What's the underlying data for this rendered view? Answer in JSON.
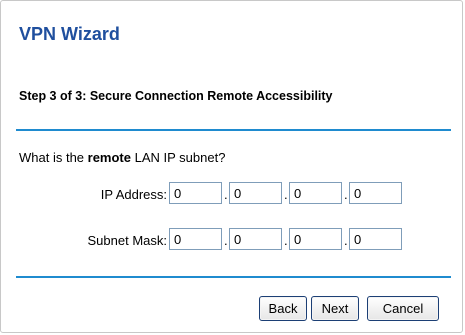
{
  "wizard": {
    "title": "VPN Wizard",
    "step": "Step 3 of 3: Secure Connection Remote Accessibility",
    "question_prefix": "What is the ",
    "question_bold": "remote",
    "question_suffix": " LAN IP subnet?"
  },
  "ip_address": {
    "label": "IP Address:",
    "octets": [
      "0",
      "0",
      "0",
      "0"
    ]
  },
  "subnet_mask": {
    "label": "Subnet Mask:",
    "octets": [
      "0",
      "0",
      "0",
      "0"
    ]
  },
  "buttons": {
    "back": "Back",
    "next": "Next",
    "cancel": "Cancel"
  },
  "separator": "."
}
